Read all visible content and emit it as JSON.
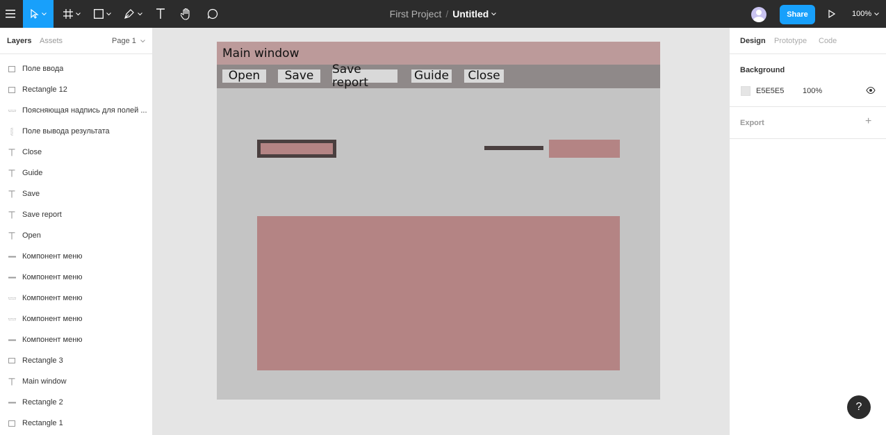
{
  "topbar": {
    "project": "First Project",
    "separator": "/",
    "file_name": "Untitled",
    "share_label": "Share",
    "zoom": "100%",
    "accent": "#18a0fb"
  },
  "left_panel": {
    "tabs": [
      "Layers",
      "Assets"
    ],
    "page": "Page 1",
    "layers": [
      {
        "name": "Поле ввода",
        "icon": "rect"
      },
      {
        "name": "Rectangle 12",
        "icon": "rect"
      },
      {
        "name": "Поясняющая надпись для полей ...",
        "icon": "line-dashed"
      },
      {
        "name": "Поле вывода результата",
        "icon": "line-vertical"
      },
      {
        "name": "Close",
        "icon": "text"
      },
      {
        "name": "Guide",
        "icon": "text"
      },
      {
        "name": "Save",
        "icon": "text"
      },
      {
        "name": "Save report",
        "icon": "text"
      },
      {
        "name": "Open",
        "icon": "text"
      },
      {
        "name": "Компонент меню",
        "icon": "line"
      },
      {
        "name": "Компонент меню",
        "icon": "line"
      },
      {
        "name": "Компонент меню",
        "icon": "line-dashed"
      },
      {
        "name": "Компонент меню",
        "icon": "line-dashed"
      },
      {
        "name": "Компонент меню",
        "icon": "line"
      },
      {
        "name": "Rectangle 3",
        "icon": "rect-flat"
      },
      {
        "name": "Main window",
        "icon": "text"
      },
      {
        "name": "Rectangle 2",
        "icon": "line"
      },
      {
        "name": "Rectangle 1",
        "icon": "rect"
      }
    ]
  },
  "right_panel": {
    "tabs": [
      "Design",
      "Prototype",
      "Code"
    ],
    "background_label": "Background",
    "background_hex": "E5E5E5",
    "background_opacity": "100%",
    "export_label": "Export"
  },
  "canvas": {
    "window_title": "Main window",
    "menu": [
      "Open",
      "Save",
      "Save report",
      "Guide",
      "Close"
    ],
    "colors": {
      "frame": "#c4c4c4",
      "title_bar": "#bc9a9a",
      "menu_bar": "#8f8989",
      "menu_button": "#d9d9d9",
      "field": "#b48484",
      "border": "#4a3f3f"
    }
  },
  "help_label": "?"
}
